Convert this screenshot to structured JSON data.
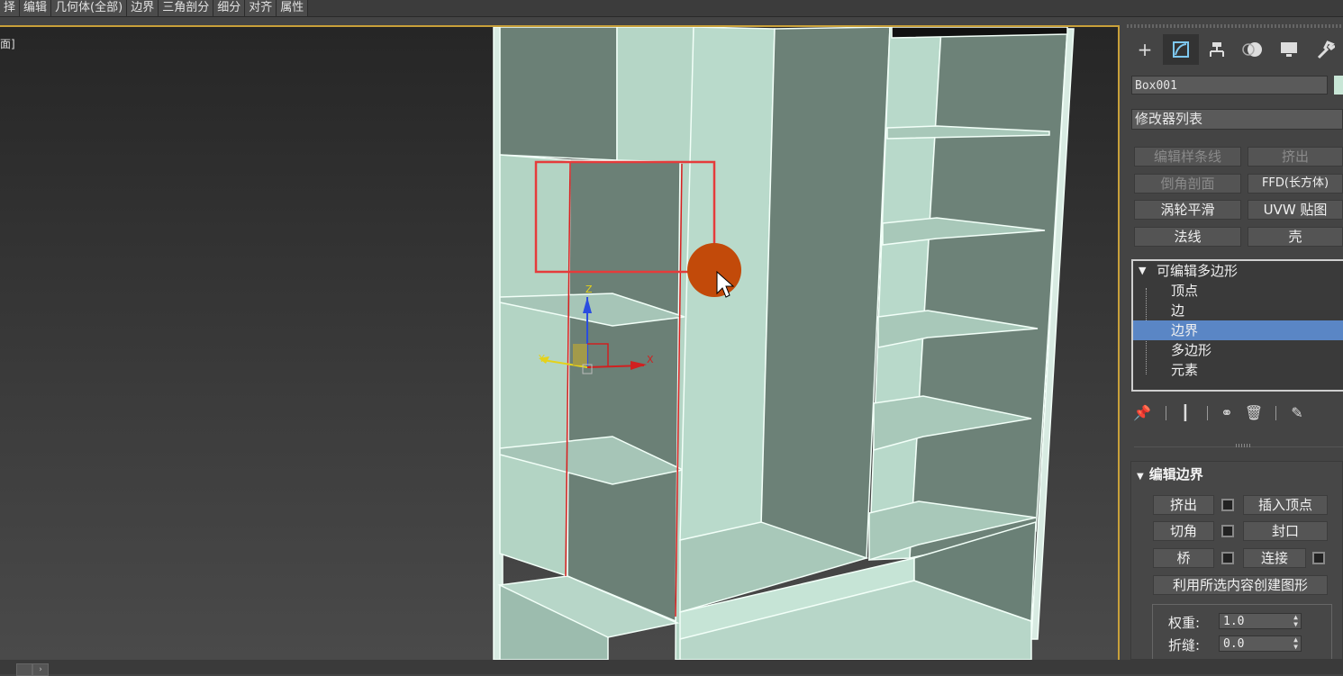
{
  "ribbon": {
    "tabs": [
      "择",
      "编辑",
      "几何体(全部)",
      "边界",
      "三角剖分",
      "细分",
      "对齐",
      "属性"
    ]
  },
  "viewport": {
    "label": "面]",
    "gizmo_axes": {
      "x": "X",
      "y": "Y",
      "z": "Z"
    }
  },
  "panel": {
    "command_tabs": [
      "create-icon",
      "modify-icon",
      "hierarchy-icon",
      "motion-icon",
      "display-icon",
      "utilities-icon"
    ],
    "object_name": "Box001",
    "modifier_list": "修改器列表",
    "modifier_buttons": [
      "编辑样条线",
      "挤出",
      "倒角剖面",
      "FFD(长方体)",
      "涡轮平滑",
      "UVW 贴图",
      "法线",
      "壳"
    ],
    "stack": {
      "root": "可编辑多边形",
      "items": [
        "顶点",
        "边",
        "边界",
        "多边形",
        "元素"
      ],
      "selected": "边界"
    },
    "edit_border": {
      "title": "编辑边界",
      "extrude": "挤出",
      "insert_vertex": "插入顶点",
      "chamfer": "切角",
      "cap": "封口",
      "bridge": "桥",
      "connect": "连接",
      "create_shape": "利用所选内容创建图形",
      "weight_label": "权重:",
      "weight_value": "1.0",
      "crease_label": "折缝:",
      "crease_value": "0.0"
    }
  },
  "colors": {
    "accent_border": "#c8a03a",
    "selection": "#5a86c5",
    "highlight_box": "#e53b3b",
    "cursor_dot": "#c24a0a"
  }
}
